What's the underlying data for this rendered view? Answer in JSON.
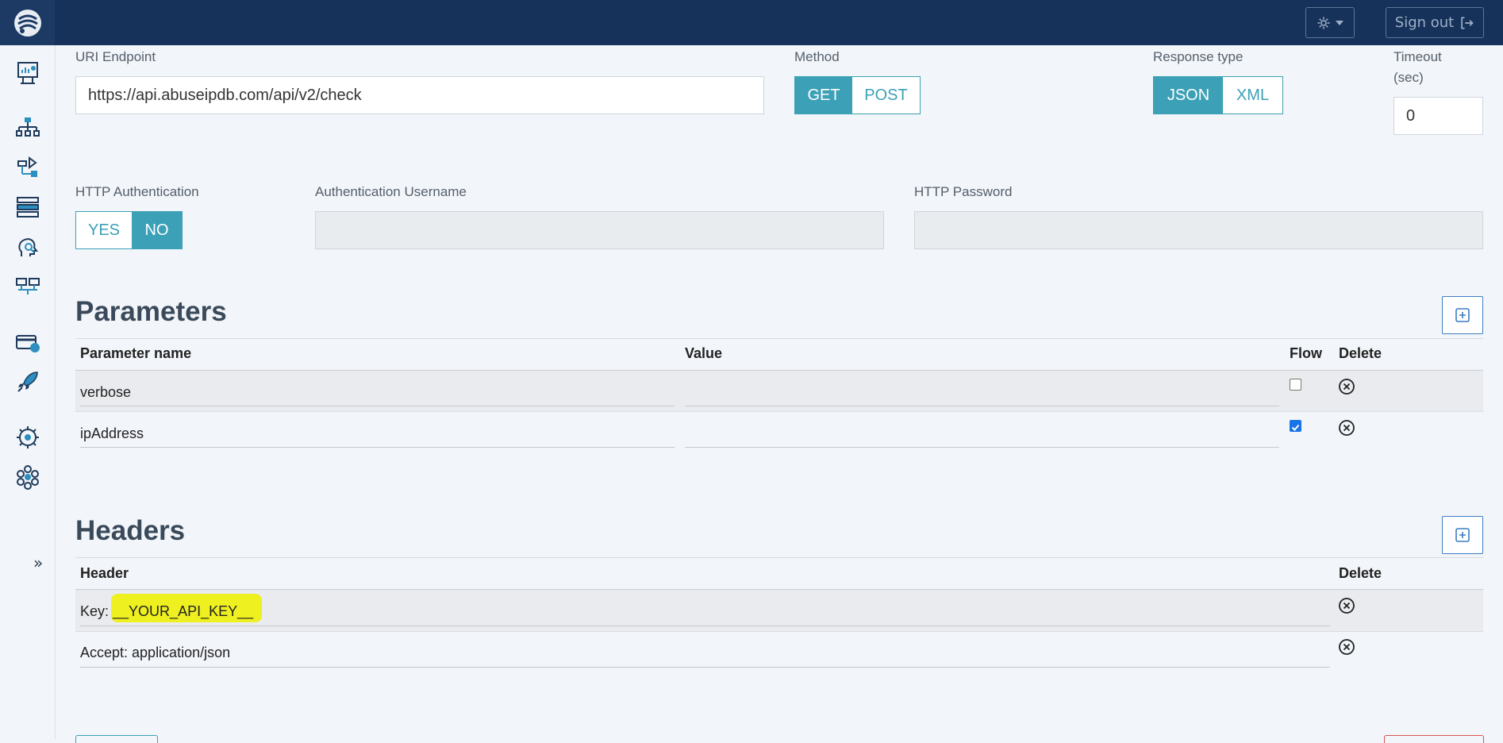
{
  "header": {
    "signout_label": "Sign out"
  },
  "form": {
    "uri_label": "URI Endpoint",
    "uri_value": "https://api.abuseipdb.com/api/v2/check",
    "method_label": "Method",
    "method_options": [
      "GET",
      "POST"
    ],
    "method_selected": "GET",
    "response_label": "Response type",
    "response_options": [
      "JSON",
      "XML"
    ],
    "response_selected": "JSON",
    "timeout_label_line1": "Timeout",
    "timeout_label_line2": "(sec)",
    "timeout_value": "0",
    "auth_label": "HTTP Authentication",
    "auth_options": [
      "YES",
      "NO"
    ],
    "auth_selected": "NO",
    "auth_user_label": "Authentication Username",
    "auth_user_value": "",
    "password_label": "HTTP Password",
    "password_value": ""
  },
  "parameters": {
    "title": "Parameters",
    "columns": [
      "Parameter name",
      "Value",
      "Flow",
      "Delete"
    ],
    "rows": [
      {
        "name": "verbose",
        "value": "",
        "flow": false
      },
      {
        "name": "ipAddress",
        "value": "",
        "flow": true
      }
    ]
  },
  "headers": {
    "title": "Headers",
    "columns": [
      "Header",
      "Delete"
    ],
    "rows": [
      {
        "prefix": "Key: ",
        "highlighted": "__YOUR_API_KEY__"
      },
      {
        "prefix": "Accept: application/json",
        "highlighted": ""
      }
    ]
  },
  "colors": {
    "topbar": "#16325a",
    "accent": "#3ca0b6",
    "add_button": "#3b7dc4",
    "highlight": "#eef020"
  },
  "icons": {
    "sidebar": [
      "dashboard-icon",
      "hierarchy-icon",
      "workflow-icon",
      "database-icon",
      "analyst-icon",
      "servers-icon",
      "payment-icon",
      "rocket-icon",
      "settings-gear-icon",
      "network-icon"
    ]
  }
}
